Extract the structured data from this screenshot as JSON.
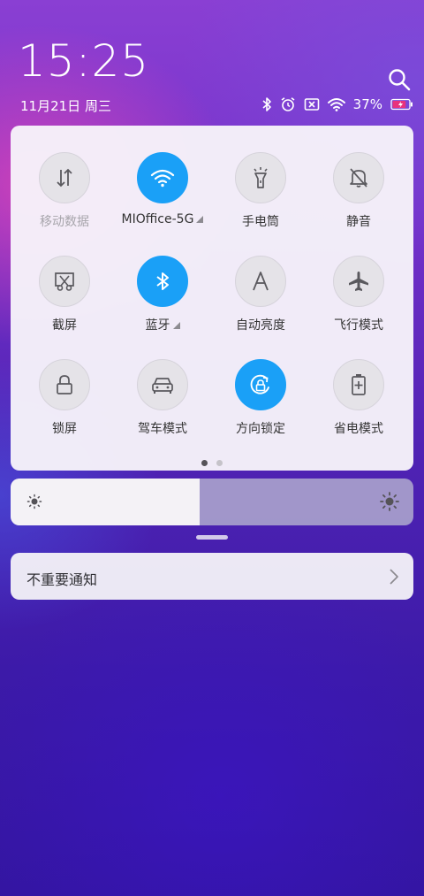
{
  "header": {
    "time": "15:25",
    "date": "11月21日 周三"
  },
  "status": {
    "battery_percent": "37%",
    "battery_level": 0.37,
    "icons": [
      "bluetooth-icon",
      "alarm-icon",
      "no-sim-icon",
      "wifi-icon",
      "battery-icon"
    ]
  },
  "quick_settings": {
    "tiles": [
      {
        "label": "移动数据",
        "icon": "mobile-data-icon",
        "active": false,
        "disabled": true
      },
      {
        "label": "MIOffice-5G",
        "icon": "wifi-icon",
        "active": true,
        "expandable": true
      },
      {
        "label": "手电筒",
        "icon": "flashlight-icon",
        "active": false
      },
      {
        "label": "静音",
        "icon": "mute-bell-icon",
        "active": false
      },
      {
        "label": "截屏",
        "icon": "screenshot-icon",
        "active": false
      },
      {
        "label": "蓝牙",
        "icon": "bluetooth-icon",
        "active": true,
        "expandable": true
      },
      {
        "label": "自动亮度",
        "icon": "auto-brightness-icon",
        "active": false
      },
      {
        "label": "飞行模式",
        "icon": "airplane-icon",
        "active": false
      },
      {
        "label": "锁屏",
        "icon": "lock-icon",
        "active": false
      },
      {
        "label": "驾车模式",
        "icon": "car-icon",
        "active": false
      },
      {
        "label": "方向锁定",
        "icon": "rotation-lock-icon",
        "active": true
      },
      {
        "label": "省电模式",
        "icon": "battery-saver-icon",
        "active": false
      }
    ],
    "page_count": 2,
    "current_page": 1
  },
  "brightness": {
    "level": 0.47
  },
  "notification": {
    "label": "不重要通知"
  },
  "colors": {
    "accent": "#1aa0f7",
    "panel": "#f7f4fa",
    "tile_inactive": "#e5e3e8",
    "icon_gray": "#505055"
  }
}
